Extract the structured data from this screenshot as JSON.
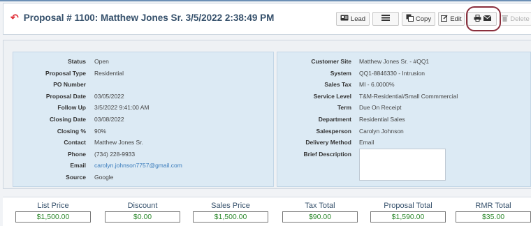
{
  "header": {
    "title_icon": "undo-icon",
    "title": "Proposal # 1100: Matthew Jones Sr. 3/5/2022 2:38:49 PM"
  },
  "toolbar": {
    "lead_label": "Lead",
    "list_label": "",
    "copy_label": "Copy",
    "edit_label": "Edit",
    "print_email_label": "",
    "delete_label": "Delete"
  },
  "left_panel": {
    "fields": [
      {
        "label": "Status",
        "value": "Open"
      },
      {
        "label": "Proposal Type",
        "value": "Residential"
      },
      {
        "label": "PO Number",
        "value": ""
      },
      {
        "label": "Proposal Date",
        "value": "03/05/2022"
      },
      {
        "label": "Follow Up",
        "value": "3/5/2022 9:41:00 AM"
      },
      {
        "label": "Closing Date",
        "value": "03/08/2022"
      },
      {
        "label": "Closing %",
        "value": "90%"
      },
      {
        "label": "Contact",
        "value": "Matthew Jones Sr."
      },
      {
        "label": "Phone",
        "value": "(734) 228-9933"
      },
      {
        "label": "Email",
        "value": "carolyn.johnson7757@gmail.com"
      },
      {
        "label": "Source",
        "value": "Google"
      }
    ]
  },
  "right_panel": {
    "fields": [
      {
        "label": "Customer Site",
        "value": "Matthew Jones Sr. - #QQ1"
      },
      {
        "label": "System",
        "value": "QQ1-8846330 - Intrusion"
      },
      {
        "label": "Sales Tax",
        "value": "MI - 6.0000%"
      },
      {
        "label": "Service Level",
        "value": "T&M-Residential/Small Commmercial"
      },
      {
        "label": "Term",
        "value": "Due On Receipt"
      },
      {
        "label": "Department",
        "value": "Residential Sales"
      },
      {
        "label": "Salesperson",
        "value": "Carolyn Johnson"
      },
      {
        "label": "Delivery Method",
        "value": "Email"
      },
      {
        "label": "Brief Description",
        "value": ""
      }
    ]
  },
  "summary": [
    {
      "label": "List Price",
      "value": "$1,500.00"
    },
    {
      "label": "Discount",
      "value": "$0.00"
    },
    {
      "label": "Sales Price",
      "value": "$1,500.00"
    },
    {
      "label": "Tax Total",
      "value": "$90.00"
    },
    {
      "label": "Proposal Total",
      "value": "$1,590.00"
    },
    {
      "label": "RMR Total",
      "value": "$35.00"
    }
  ],
  "colors": {
    "title": "#35506b",
    "accent_red": "#e0313a",
    "money_green": "#2f8a2f",
    "panel_bg": "#dceaf4",
    "link": "#3a7cbc"
  }
}
